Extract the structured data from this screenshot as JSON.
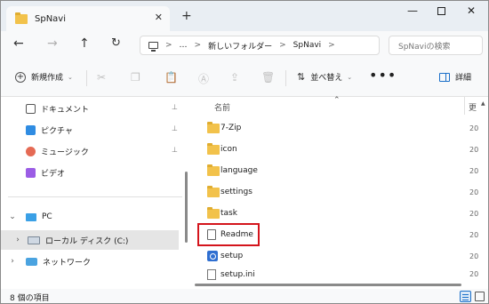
{
  "window": {
    "tab_title": "SpNavi",
    "tab_close": "✕",
    "new_tab": "+",
    "minimize": "—",
    "close": "✕"
  },
  "address_bar": {
    "back": "←",
    "forward": "→",
    "up": "↑",
    "refresh": "↻",
    "crumbs": [
      "…",
      "新しいフォルダー",
      "SpNavi"
    ],
    "separator": ">",
    "search_placeholder": "SpNaviの検索"
  },
  "command_bar": {
    "new_label": "新規作成",
    "sort_label": "並べ替え",
    "more": "•••",
    "details_label": "詳細"
  },
  "nav_pane": {
    "quick_access": [
      {
        "label": "ドキュメント",
        "icon": "documents-icon"
      },
      {
        "label": "ピクチャ",
        "icon": "pictures-icon"
      },
      {
        "label": "ミュージック",
        "icon": "music-icon"
      },
      {
        "label": "ビデオ",
        "icon": "videos-icon"
      }
    ],
    "pin_glyph": "📌",
    "this_pc": "PC",
    "local_disk": "ローカル ディスク (C:)",
    "network": "ネットワーク"
  },
  "file_list": {
    "column_name": "名前",
    "column_date": "更",
    "date_prefix": "20",
    "items": [
      {
        "name": "7-Zip",
        "type": "folder"
      },
      {
        "name": "icon",
        "type": "folder"
      },
      {
        "name": "language",
        "type": "folder"
      },
      {
        "name": "settings",
        "type": "folder"
      },
      {
        "name": "task",
        "type": "folder"
      },
      {
        "name": "Readme",
        "type": "text-file"
      },
      {
        "name": "setup",
        "type": "application"
      },
      {
        "name": "setup.ini",
        "type": "config-file"
      }
    ],
    "highlighted_item": "Readme",
    "highlight_color": "#d4141c"
  },
  "status_bar": {
    "item_count": "8 個の項目"
  },
  "colors": {
    "accent": "#1a6fc9",
    "folder": "#f2c24b",
    "highlight_border": "#d4141c"
  }
}
